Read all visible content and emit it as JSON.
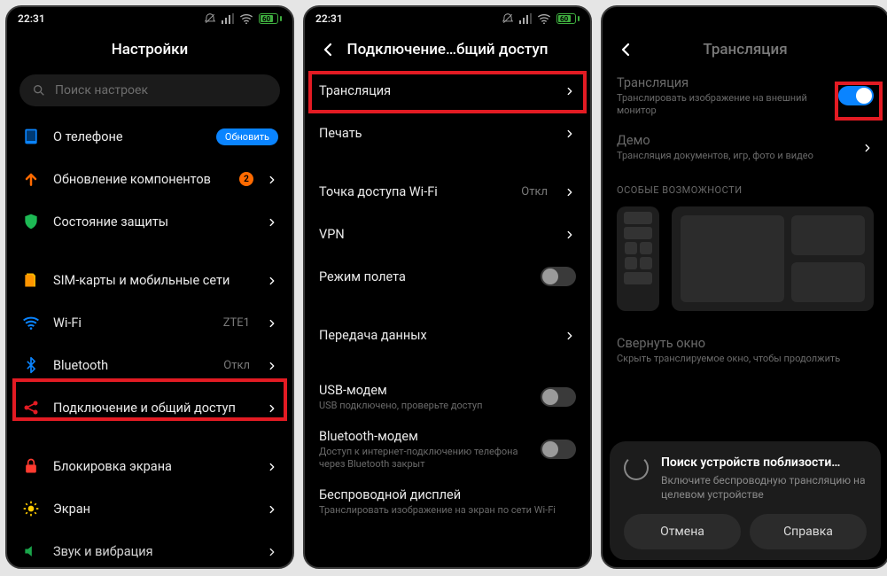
{
  "status": {
    "time": "22:31",
    "battery_pct": "60"
  },
  "screen1": {
    "title": "Настройки",
    "search_placeholder": "Поиск настроек",
    "items": {
      "about": {
        "label": "О телефоне",
        "badge": "Обновить"
      },
      "updates": {
        "label": "Обновление компонентов",
        "count": "2"
      },
      "security": {
        "label": "Состояние защиты"
      },
      "sim": {
        "label": "SIM-карты и мобильные сети"
      },
      "wifi": {
        "label": "Wi-Fi",
        "value": "ZTE1"
      },
      "bt": {
        "label": "Bluetooth",
        "value": "Откл"
      },
      "share": {
        "label": "Подключение и общий доступ"
      },
      "lock": {
        "label": "Блокировка экрана"
      },
      "display": {
        "label": "Экран"
      },
      "sound": {
        "label": "Звук и вибрация"
      }
    }
  },
  "screen2": {
    "title": "Подключение…бщий доступ",
    "items": {
      "cast": {
        "label": "Трансляция"
      },
      "print": {
        "label": "Печать"
      },
      "hotspot": {
        "label": "Точка доступа Wi-Fi",
        "value": "Откл"
      },
      "vpn": {
        "label": "VPN"
      },
      "airplane": {
        "label": "Режим полета"
      },
      "data": {
        "label": "Передача данных"
      },
      "usb": {
        "label": "USB-модем",
        "sub": "USB подключено, проверьте доступ"
      },
      "btm": {
        "label": "Bluetooth-модем",
        "sub": "Доступ к интернет-подключению телефона через Bluetooth закрыт"
      },
      "wdisp": {
        "label": "Беспроводной дисплей",
        "sub": "Транслировать изображение на экран по сети Wi-Fi"
      }
    }
  },
  "screen3": {
    "title": "Трансляция",
    "cast": {
      "label": "Трансляция",
      "sub": "Транслировать изображение на внешний монитор"
    },
    "demo": {
      "label": "Демо",
      "sub": "Трансляция документов, игр, фото и видео"
    },
    "section": "ОСОБЫЕ ВОЗМОЖНОСТИ",
    "minimize": {
      "label": "Свернуть окно",
      "sub": "Скрыть транслируемое окно, чтобы продолжить"
    },
    "sheet": {
      "title": "Поиск устройств поблизости…",
      "msg": "Включите беспроводную трансляцию на целевом устройстве",
      "cancel": "Отмена",
      "help": "Справка"
    }
  }
}
